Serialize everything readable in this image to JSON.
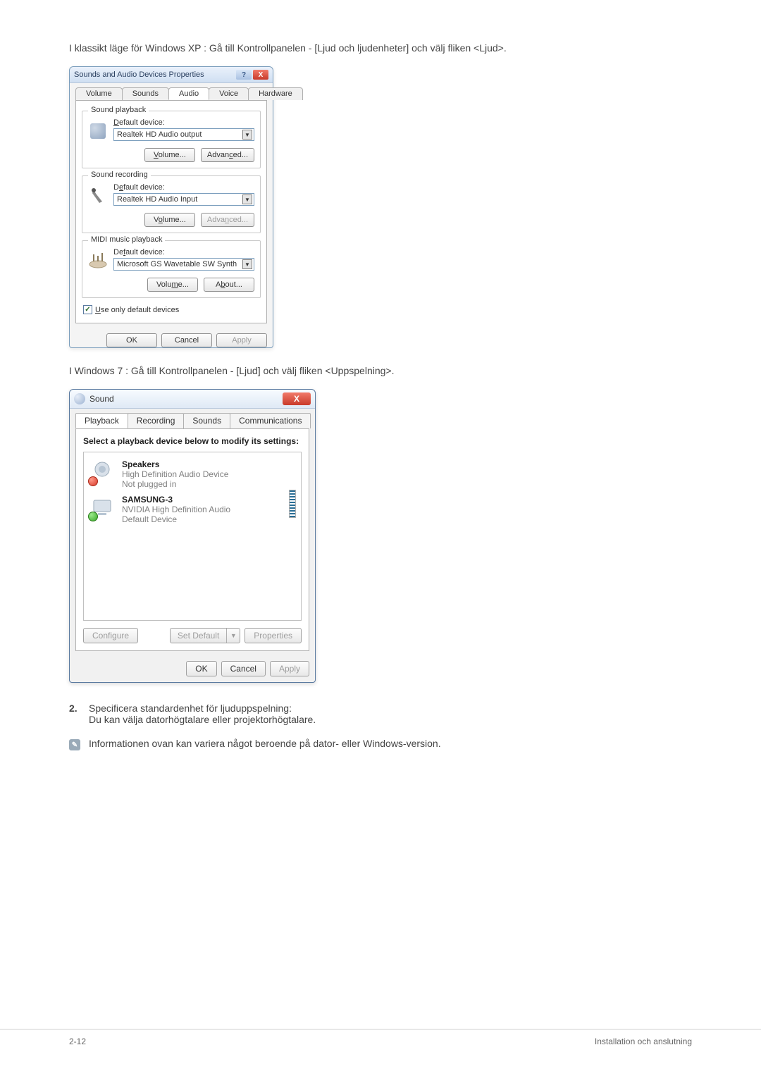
{
  "intro_xp": "I klassikt läge för Windows XP : Gå till Kontrollpanelen - [Ljud och ljudenheter] och välj fliken <Ljud>.",
  "intro_7": "I Windows 7 : Gå till Kontrollpanelen - [Ljud] och välj fliken <Uppspelning>.",
  "xp": {
    "title": "Sounds and Audio Devices Properties",
    "help_char": "?",
    "close_char": "X",
    "tabs": {
      "volume": "Volume",
      "sounds": "Sounds",
      "audio": "Audio",
      "voice": "Voice",
      "hardware": "Hardware"
    },
    "playback": {
      "group": "Sound playback",
      "label_pre": "D",
      "label_post": "efault device:",
      "device": "Realtek HD Audio output",
      "volume_u": "V",
      "volume_post": "olume...",
      "adv_pre": "Advan",
      "adv_u": "c",
      "adv_post": "ed..."
    },
    "recording": {
      "group": "Sound recording",
      "label_pre": "D",
      "label_u": "e",
      "label_post": "fault device:",
      "device": "Realtek HD Audio Input",
      "vol_pre": "V",
      "vol_u": "o",
      "vol_post": "lume...",
      "adv_pre": "Adva",
      "adv_u": "n",
      "adv_post": "ced..."
    },
    "midi": {
      "group": "MIDI music playback",
      "label_pre": "De",
      "label_u": "f",
      "label_post": "ault device:",
      "device": "Microsoft GS Wavetable SW Synth",
      "vol_pre": "Volu",
      "vol_u": "m",
      "vol_post": "e...",
      "about_pre": "A",
      "about_u": "b",
      "about_post": "out..."
    },
    "use_only_u": "U",
    "use_only_post": "se only default devices",
    "ok": "OK",
    "cancel": "Cancel",
    "apply": "Apply"
  },
  "w7": {
    "title": "Sound",
    "close_char": "X",
    "tabs": {
      "playback": "Playback",
      "recording": "Recording",
      "sounds": "Sounds",
      "communications": "Communications"
    },
    "instruction": "Select a playback device below to modify its settings:",
    "devices": [
      {
        "name": "Speakers",
        "line2": "High Definition Audio Device",
        "line3": "Not plugged in",
        "badge": "red"
      },
      {
        "name": "SAMSUNG-3",
        "line2": "NVIDIA High Definition Audio",
        "line3": "Default Device",
        "badge": "green"
      }
    ],
    "configure": "Configure",
    "set_default": "Set Default",
    "properties": "Properties",
    "ok": "OK",
    "cancel": "Cancel",
    "apply": "Apply"
  },
  "step2": {
    "num": "2.",
    "line1": "Specificera standardenhet för ljuduppspelning:",
    "line2": "Du kan välja datorhögtalare eller projektorhögtalare."
  },
  "note": "Informationen ovan kan variera något beroende på dator- eller Windows-version.",
  "footer": {
    "page": "2-12",
    "section": "Installation och anslutning"
  }
}
